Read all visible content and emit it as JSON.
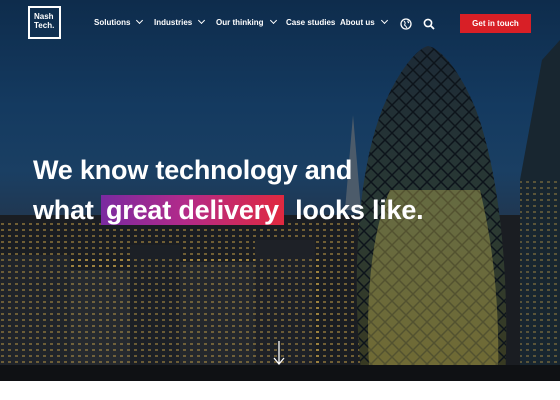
{
  "brand": {
    "logo_line1": "Nash",
    "logo_line2": "Tech."
  },
  "nav": {
    "items": [
      {
        "label": "Solutions",
        "has_dropdown": true
      },
      {
        "label": "Industries",
        "has_dropdown": true
      },
      {
        "label": "Our thinking",
        "has_dropdown": true
      },
      {
        "label": "Case studies",
        "has_dropdown": false
      },
      {
        "label": "About us",
        "has_dropdown": true
      }
    ],
    "icons": [
      "globe-icon",
      "search-icon"
    ],
    "cta_label": "Get in touch"
  },
  "hero": {
    "line1": "We know technology and",
    "line2_before": "what",
    "line2_highlight": "great delivery",
    "line2_after": "looks like.",
    "scroll_icon": "down-arrow-icon"
  },
  "colors": {
    "cta": "#d81f26",
    "highlight_start": "#7a2aa0",
    "highlight_end": "#e0293f",
    "text": "#ffffff"
  }
}
